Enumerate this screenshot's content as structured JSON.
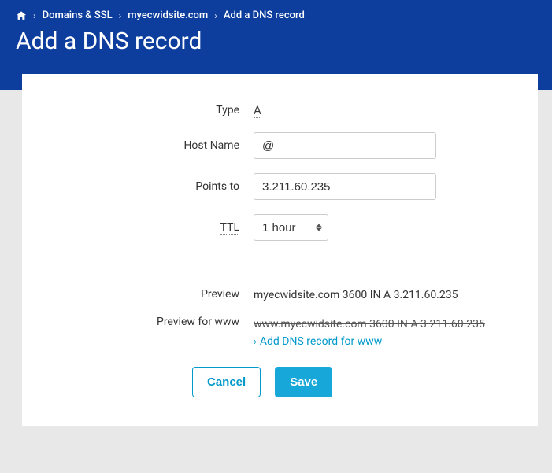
{
  "breadcrumb": {
    "items": [
      "Domains & SSL",
      "myecwidsite.com",
      "Add a DNS record"
    ]
  },
  "page_title": "Add a DNS record",
  "form": {
    "type_label": "Type",
    "type_value": "A",
    "hostname_label": "Host Name",
    "hostname_value": "@",
    "pointsto_label": "Points to",
    "pointsto_value": "3.211.60.235",
    "ttl_label": "TTL",
    "ttl_value": "1 hour"
  },
  "preview": {
    "label": "Preview",
    "value": "myecwidsite.com   3600   IN   A   3.211.60.235",
    "www_label": "Preview for www",
    "www_value": "www.myecwidsite.com   3600   IN   A   3.211.60.235",
    "add_link": "Add DNS record for www"
  },
  "buttons": {
    "cancel": "Cancel",
    "save": "Save"
  }
}
